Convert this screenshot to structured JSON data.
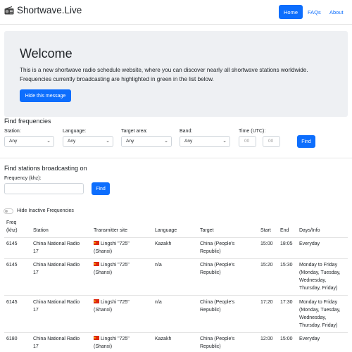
{
  "nav": {
    "brand": "Shortwave.Live",
    "home": "Home",
    "faqs": "FAQs",
    "about": "About"
  },
  "welcome": {
    "title": "Welcome",
    "text": "This is a new shortwave radio schedule website, where you can discover nearly all shortwave stations worldwide. Frequencies currently broadcasting are highlighted in green in the list below.",
    "button": "Hide this message"
  },
  "find_freq": {
    "title": "Find frequencies",
    "station_label": "Station:",
    "station_value": "Any",
    "language_label": "Language:",
    "language_value": "Any",
    "target_label": "Target area:",
    "target_value": "Any",
    "band_label": "Band:",
    "band_value": "Any",
    "time_label": "Time (UTC):",
    "time_from": "00",
    "time_to": "00",
    "button": "Find"
  },
  "find_station": {
    "title": "Find stations broadcasting on",
    "label": "Frequency (khz):",
    "button": "Find"
  },
  "toggle_label": "Hide Inactive Frequencies",
  "table": {
    "headers": {
      "freq1": "Freq",
      "freq2": "(khz)",
      "station": "Station",
      "site": "Transmitter site",
      "language": "Language",
      "target": "Target",
      "start": "Start",
      "end": "End",
      "days": "Days/Info"
    },
    "rows": [
      {
        "freq": "6145",
        "station1": "China National Radio",
        "station2": "17",
        "site1": "Lingshi \"725\"",
        "site2": "(Shanxi)",
        "language": "Kazakh",
        "target1": "China (People's",
        "target2": "Republic)",
        "start": "15:00",
        "end": "18:05",
        "days": [
          "Everyday"
        ]
      },
      {
        "freq": "6145",
        "station1": "China National Radio",
        "station2": "17",
        "site1": "Lingshi \"725\"",
        "site2": "(Shanxi)",
        "language": "n/a",
        "target1": "China (People's",
        "target2": "Republic)",
        "start": "15:20",
        "end": "15:30",
        "days": [
          "Monday to Friday",
          "(Monday, Tuesday,",
          "Wednesday,",
          "Thursday, Friday)"
        ]
      },
      {
        "freq": "6145",
        "station1": "China National Radio",
        "station2": "17",
        "site1": "Lingshi \"725\"",
        "site2": "(Shanxi)",
        "language": "n/a",
        "target1": "China (People's",
        "target2": "Republic)",
        "start": "17:20",
        "end": "17:30",
        "days": [
          "Monday to Friday",
          "(Monday, Tuesday,",
          "Wednesday,",
          "Thursday, Friday)"
        ]
      },
      {
        "freq": "6180",
        "station1": "China National Radio",
        "station2": "17",
        "site1": "Lingshi \"725\"",
        "site2": "(Shanxi)",
        "language": "Kazakh",
        "target1": "China (People's",
        "target2": "Republic)",
        "start": "12:00",
        "end": "15:00",
        "days": [
          "Everyday"
        ]
      }
    ]
  }
}
